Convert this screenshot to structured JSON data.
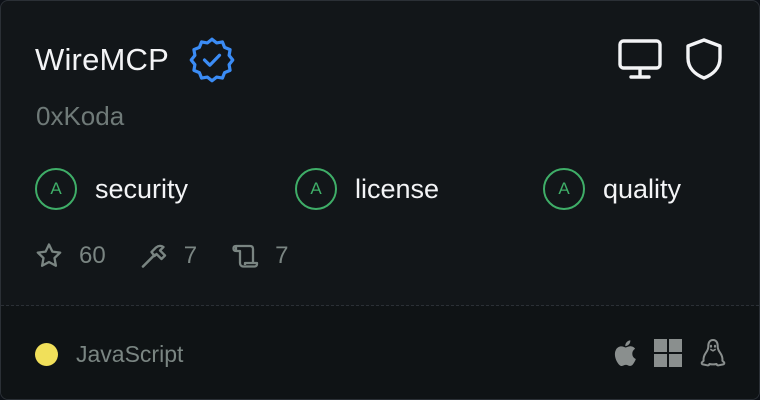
{
  "server": {
    "name": "WireMCP",
    "owner": "0xKoda",
    "verified_icon": "verified-badge-icon"
  },
  "header_icons": [
    "monitor-icon",
    "shield-icon"
  ],
  "grades": [
    {
      "grade": "A",
      "label": "security"
    },
    {
      "grade": "A",
      "label": "license"
    },
    {
      "grade": "A",
      "label": "quality"
    }
  ],
  "stats": {
    "stars": "60",
    "tools": "7",
    "resources": "7"
  },
  "footer": {
    "language": "JavaScript",
    "language_color": "#f1e05a",
    "platforms": [
      "apple-icon",
      "windows-icon",
      "linux-icon"
    ]
  },
  "colors": {
    "grade_green": "#3fae68",
    "verified_blue": "#3b8cf5"
  }
}
